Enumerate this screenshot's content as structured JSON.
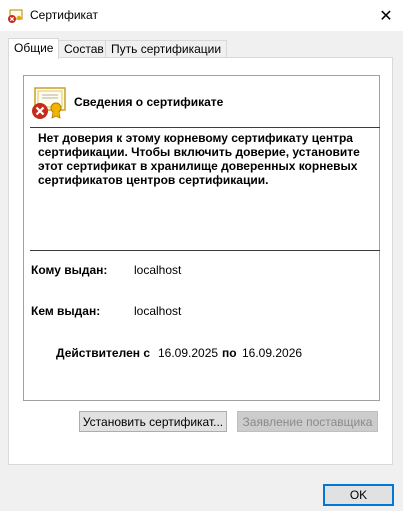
{
  "window": {
    "title": "Сертификат",
    "close_glyph": "✕"
  },
  "tabs": [
    {
      "label": "Общие"
    },
    {
      "label": "Состав"
    },
    {
      "label": "Путь сертификации"
    }
  ],
  "info": {
    "title": "Сведения о сертификате",
    "warning": "Нет доверия к этому корневому сертификату центра сертификации. Чтобы включить доверие, установите этот сертификат в хранилище доверенных корневых сертификатов центров сертификации."
  },
  "fields": {
    "issued_to_label": "Кому выдан:",
    "issued_to_value": "localhost",
    "issued_by_label": "Кем выдан:",
    "issued_by_value": "localhost",
    "valid_from_label": "Действителен с",
    "valid_from_value": "16.09.2025",
    "valid_to_label": "по",
    "valid_to_value": "16.09.2026"
  },
  "buttons": {
    "install": "Установить сертификат...",
    "issuer_statement": "Заявление поставщика",
    "ok": "OK"
  },
  "colors": {
    "accent": "#0078d7",
    "error_red": "#c42b1c"
  }
}
